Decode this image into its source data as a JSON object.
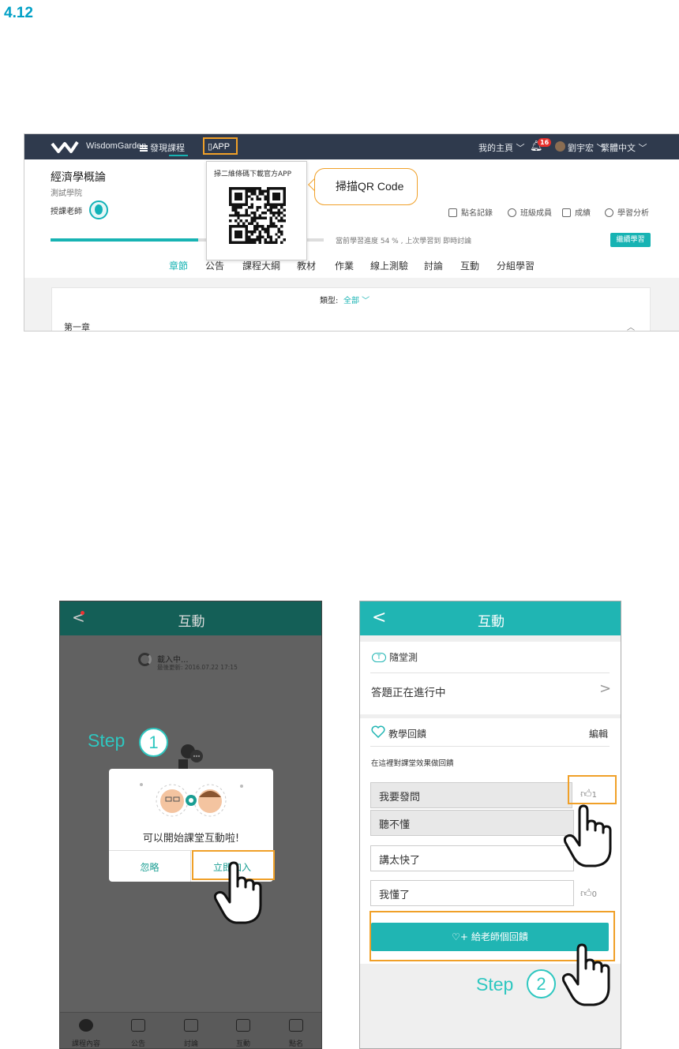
{
  "section_number": "4.12",
  "web": {
    "brand": "WisdomGarden",
    "nav_discover": "發現課程",
    "nav_app": "APP",
    "nav_myhome": "我的主頁 ﹀",
    "notification_count": "16",
    "user_name": "劉宇宏 ﹀",
    "language": "繁體中文 ﹀",
    "course_title": "經濟學概論",
    "college": "測試學院",
    "teacher_label": "授課老師",
    "tools": [
      "點名記錄",
      "班級成員",
      "成績",
      "學習分析"
    ],
    "progress_percent": 54,
    "progress_text": "當前學習進度 54 % , 上次學習到 即時討論",
    "continue_label": "繼續學習",
    "tabs": [
      "章節",
      "公告",
      "課程大綱",
      "教材",
      "作業",
      "線上測驗",
      "討論",
      "互動",
      "分組學習"
    ],
    "active_tab": "章節",
    "type_label": "類型:",
    "type_value": "全部 ﹀",
    "chapter_label": "第一章",
    "qr_caption": "掃二維條碼下載官方APP",
    "callout": "掃描QR Code"
  },
  "phone1": {
    "title": "互動",
    "loading": "載入中...",
    "updated": "最後更新: 2016.07.22 17:15",
    "dialog_message": "可以開始課堂互動啦!",
    "ignore_label": "忽略",
    "join_label": "立即加入",
    "step_label": "Step",
    "step_number": "1",
    "bottom_tabs": [
      "課程內容",
      "公告",
      "討論",
      "互動",
      "點名"
    ]
  },
  "phone2": {
    "title": "互動",
    "quiz_icon": "T",
    "quiz_label": "隨堂測",
    "quiz_status": "答題正在進行中",
    "feedback_label": "教學回饋",
    "edit_label": "編輯",
    "feedback_hint": "在這裡對課堂效果做回饋",
    "options": [
      {
        "label": "我要發問",
        "count": "1"
      },
      {
        "label": "聽不懂",
        "count": ""
      },
      {
        "label": "講太快了",
        "count": ""
      },
      {
        "label": "我懂了",
        "count": "0"
      }
    ],
    "feedback_button": "給老師個回饋",
    "step_label": "Step",
    "step_number": "2"
  },
  "colors": {
    "nav_bg": "#2f3a4d",
    "accent": "#17b3b3",
    "highlight": "#f0a028",
    "phone1_header": "#145f57",
    "phone2_header": "#20b5b3"
  }
}
